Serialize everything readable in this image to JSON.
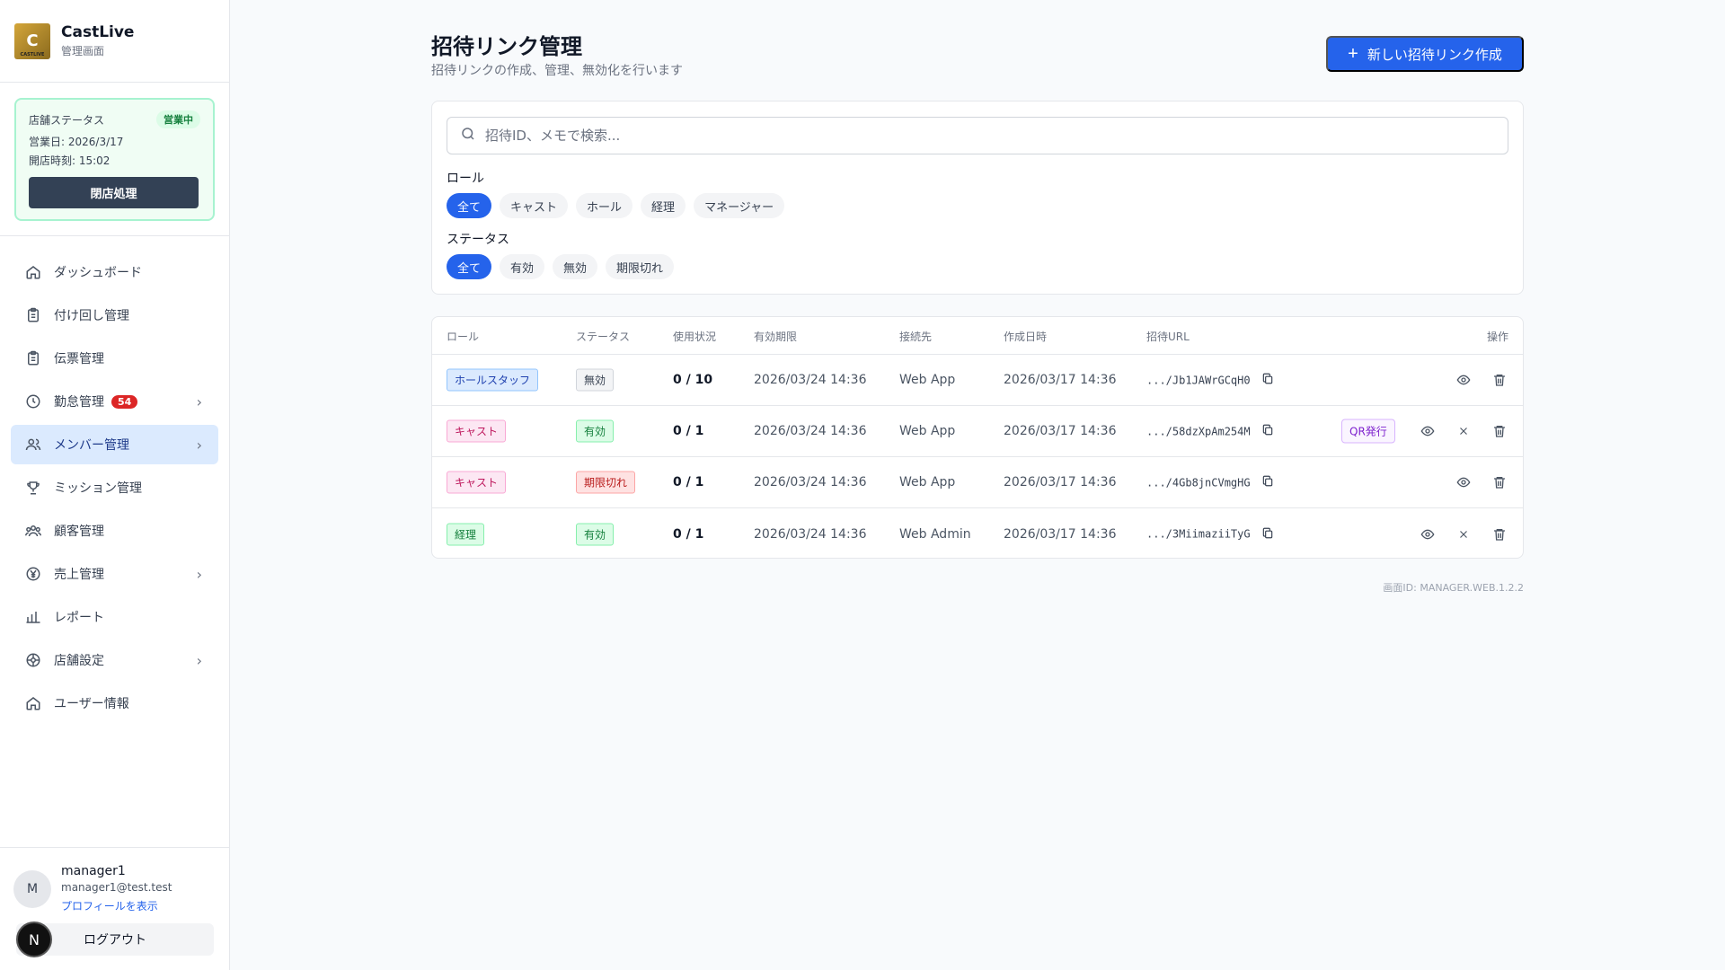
{
  "brand": {
    "title": "CastLive",
    "subtitle": "管理画面",
    "logo_text": "CASTLIVE"
  },
  "store_status": {
    "label": "店舗ステータス",
    "badge": "営業中",
    "business_day": "営業日: 2026/3/17",
    "open_time": "開店時刻: 15:02",
    "close_button": "閉店処理"
  },
  "nav": {
    "items": [
      {
        "label": "ダッシュボード",
        "icon": "home-icon"
      },
      {
        "label": "付け回し管理",
        "icon": "clipboard-icon"
      },
      {
        "label": "伝票管理",
        "icon": "clipboard-icon"
      },
      {
        "label": "勤怠管理",
        "icon": "clock-icon",
        "badge": "54"
      },
      {
        "label": "メンバー管理",
        "icon": "users-icon"
      },
      {
        "label": "ミッション管理",
        "icon": "trophy-icon"
      },
      {
        "label": "顧客管理",
        "icon": "customers-icon"
      },
      {
        "label": "売上管理",
        "icon": "yen-icon"
      },
      {
        "label": "レポート",
        "icon": "chart-icon"
      },
      {
        "label": "店舗設定",
        "icon": "settings-icon"
      },
      {
        "label": "ユーザー情報",
        "icon": "home-icon"
      }
    ]
  },
  "user": {
    "initial": "M",
    "name": "manager1",
    "email": "manager1@test.test",
    "profile_link": "プロフィールを表示",
    "logout": "ログアウト",
    "n_badge": "N"
  },
  "page": {
    "title": "招待リンク管理",
    "subtitle": "招待リンクの作成、管理、無効化を行います",
    "create_button": "新しい招待リンク作成",
    "screen_id": "画面ID: MANAGER.WEB.1.2.2"
  },
  "filters": {
    "search_placeholder": "招待ID、メモで検索...",
    "role_label": "ロール",
    "roles": [
      "全て",
      "キャスト",
      "ホール",
      "経理",
      "マネージャー"
    ],
    "status_label": "ステータス",
    "statuses": [
      "全て",
      "有効",
      "無効",
      "期限切れ"
    ]
  },
  "table": {
    "headers": [
      "ロール",
      "ステータス",
      "使用状況",
      "有効期限",
      "接続先",
      "作成日時",
      "招待URL",
      "操作"
    ],
    "rows": [
      {
        "role": "ホールスタッフ",
        "status": "無効",
        "usage": "0 / 10",
        "expires": "2026/03/24 14:36",
        "target": "Web App",
        "created": "2026/03/17 14:36",
        "url": ".../Jb1JAWrGCqH0"
      },
      {
        "role": "キャスト",
        "status": "有効",
        "usage": "0 / 1",
        "expires": "2026/03/24 14:36",
        "target": "Web App",
        "created": "2026/03/17 14:36",
        "url": ".../58dzXpAm254M",
        "qr": "QR発行"
      },
      {
        "role": "キャスト",
        "status": "期限切れ",
        "usage": "0 / 1",
        "expires": "2026/03/24 14:36",
        "target": "Web App",
        "created": "2026/03/17 14:36",
        "url": ".../4Gb8jnCVmgHG"
      },
      {
        "role": "経理",
        "status": "有効",
        "usage": "0 / 1",
        "expires": "2026/03/24 14:36",
        "target": "Web Admin",
        "created": "2026/03/17 14:36",
        "url": ".../3MiimaziiTyG"
      }
    ]
  },
  "colors": {
    "primary": "#2563eb",
    "active_nav": "#dbeafe",
    "danger": "#dc2626"
  }
}
